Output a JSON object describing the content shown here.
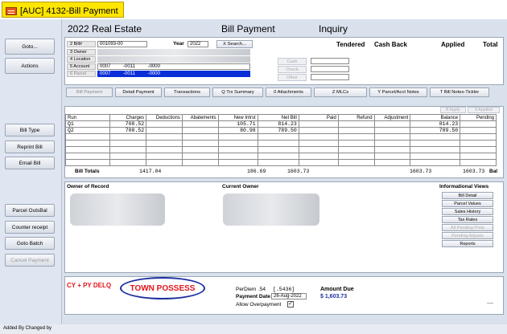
{
  "window": {
    "title": "[AUC] 4132-Bill Payment"
  },
  "sidebar": {
    "goto": "Goto...",
    "actions": "Actions",
    "bill_type": "Bill Type",
    "reprint_bill": "Reprint Bill",
    "email_bill": "Email Bill",
    "parcel_outsbal": "Parcel OutsBal",
    "counter_receipt": "Counter receipt",
    "goto_batch": "Goto Batch",
    "cancel_payment": "Cancel Payment"
  },
  "header": {
    "title": "2022 Real Estate",
    "subtitle": "Bill Payment",
    "mode": "Inquiry",
    "tendered": "Tendered",
    "cash_back": "Cash Back",
    "applied": "Applied",
    "total": "Total"
  },
  "info": {
    "bill_label": "2 Bill#",
    "bill_value": "001093-00",
    "year_label": "Year",
    "year_value": "2022",
    "search_btn": "X Search...",
    "owner_label": "3 Owner",
    "location_label": "4 Location",
    "account_label": "5 Account",
    "account_a": "0007",
    "account_b": "-0011",
    "account_c": "-0000",
    "parcel_label": "6 Parcel",
    "parcel_a": "0007",
    "parcel_b": "-0011",
    "parcel_c": "-0000",
    "cash": "Cash",
    "check": "Check",
    "other": "Other"
  },
  "tabs": [
    "Bill Payment",
    "Detail Payment",
    "Transactions",
    "Q Trx Summary",
    "0 Attachments",
    "Z MLCs",
    "Y Parcel/Acct Notes",
    "T Bill Notes-Tickler"
  ],
  "grid": {
    "apply_btn": "8 Apply",
    "apply_btn2": "9 Applied",
    "columns": [
      "Run",
      "Charges",
      "Deductions",
      "Abatements",
      "New Intrst",
      "Net Bill",
      "Paid",
      "Refund",
      "Adjustment",
      "Balance",
      "Pending"
    ],
    "rows": [
      [
        "Q1",
        "708.52",
        "",
        "",
        "105.71",
        "814.23",
        "",
        "",
        "",
        "814.23",
        ""
      ],
      [
        "Q2",
        "708.52",
        "",
        "",
        "80.98",
        "789.50",
        "",
        "",
        "",
        "789.50",
        ""
      ]
    ],
    "totals_label": "Bill Totals",
    "totals": {
      "charges": "1417.04",
      "new_intrst": "186.69",
      "net_bill": "1603.73",
      "balance": "1603.73",
      "pending": "1603.73",
      "bal_label": "Bal"
    }
  },
  "owner": {
    "owner_of_record": "Owner of Record",
    "current_owner": "Current Owner",
    "info_views_title": "Informational Views",
    "views": [
      "Bill Detail",
      "Parcel Values",
      "Sales History",
      "Tax Rates",
      "All Pending Pmts",
      "Pending Adjusts",
      "Reports"
    ]
  },
  "bottom": {
    "delq": "CY + PY DELQ",
    "town_possess": "TOWN POSSESS",
    "perdiem_label": "PerDiem",
    "perdiem_value": ".54",
    "perdiem_ext": "[.5436]",
    "payment_date_label": "Payment Date",
    "payment_date_value": "26-Aug-2022",
    "allow_overpayment": "Allow Overpayment",
    "amount_due_label": "Amount Due",
    "amount_due_value": "$ 1,603.73",
    "dash": "—"
  },
  "footer": {
    "text": "Added By Changed by"
  },
  "colors": {
    "title_bg": "#ffe600",
    "selected_row": "#0a2fd8",
    "town_possess": "#e2141b",
    "accent_blue": "#1b2fa0"
  }
}
